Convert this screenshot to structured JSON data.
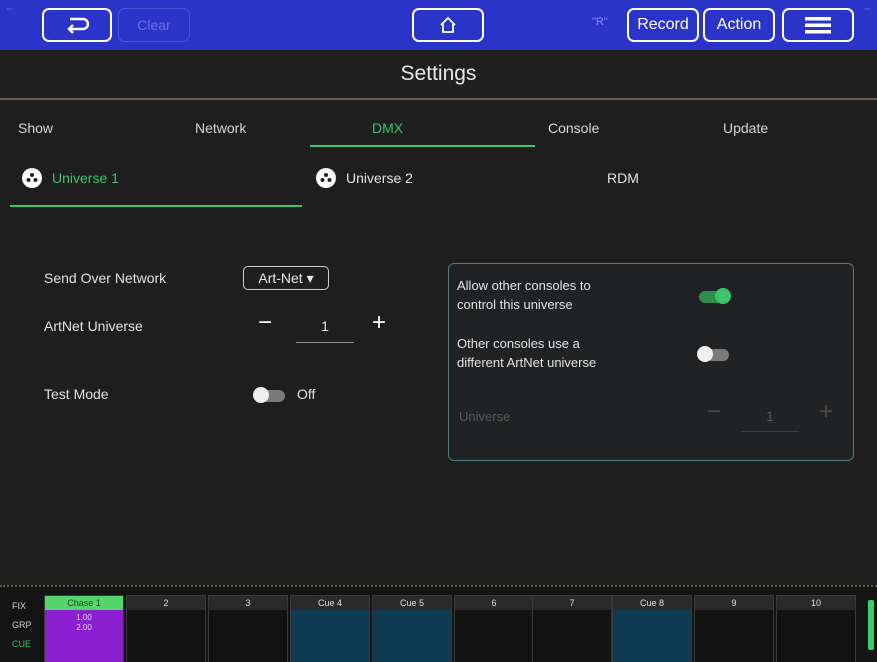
{
  "topbar": {
    "back_icon": "undo-icon",
    "clear_label": "Clear",
    "home_icon": "home-icon",
    "indicator_label": "\"R\"",
    "record_label": "Record",
    "action_label": "Action",
    "menu_icon": "hamburger-menu-icon",
    "bg_color": "#2b34c9"
  },
  "title": "Settings",
  "tabs": [
    {
      "label": "Show",
      "active": false
    },
    {
      "label": "Network",
      "active": false
    },
    {
      "label": "DMX",
      "active": true
    },
    {
      "label": "Console",
      "active": false
    },
    {
      "label": "Update",
      "active": false
    }
  ],
  "subtabs": [
    {
      "label": "Universe 1",
      "icon": "dmx-connector-icon",
      "active": true
    },
    {
      "label": "Universe 2",
      "icon": "dmx-connector-icon",
      "active": false
    },
    {
      "label": "RDM",
      "active": false
    }
  ],
  "settings": {
    "send_over_network_label": "Send Over Network",
    "send_over_network_value": "Art-Net ▾",
    "artnet_universe_label": "ArtNet Universe",
    "artnet_universe_value": "1",
    "test_mode_label": "Test Mode",
    "test_mode_state": "Off"
  },
  "panel": {
    "allow_control_line1": "Allow other consoles to",
    "allow_control_line2": "control this universe",
    "allow_control_on": true,
    "different_universe_line1": "Other consoles use a",
    "different_universe_line2": "different ArtNet universe",
    "different_universe_on": false,
    "universe_label": "Universe",
    "universe_value": "1"
  },
  "bottom": {
    "row_labels": [
      "FIX",
      "GRP",
      "CUE"
    ],
    "first_slot": {
      "label": "Chase 1",
      "line1": "1.00",
      "line2": "2.00"
    },
    "slots": [
      "2",
      "3",
      "Cue 4",
      "Cue 5",
      "6",
      "7",
      "Cue 8",
      "9",
      "10"
    ]
  },
  "colors": {
    "accent_green": "#3cc56b",
    "panel_border": "#4f7c86",
    "cue_blue": "#0f3b52",
    "chase_purple": "#8c1fcf"
  }
}
